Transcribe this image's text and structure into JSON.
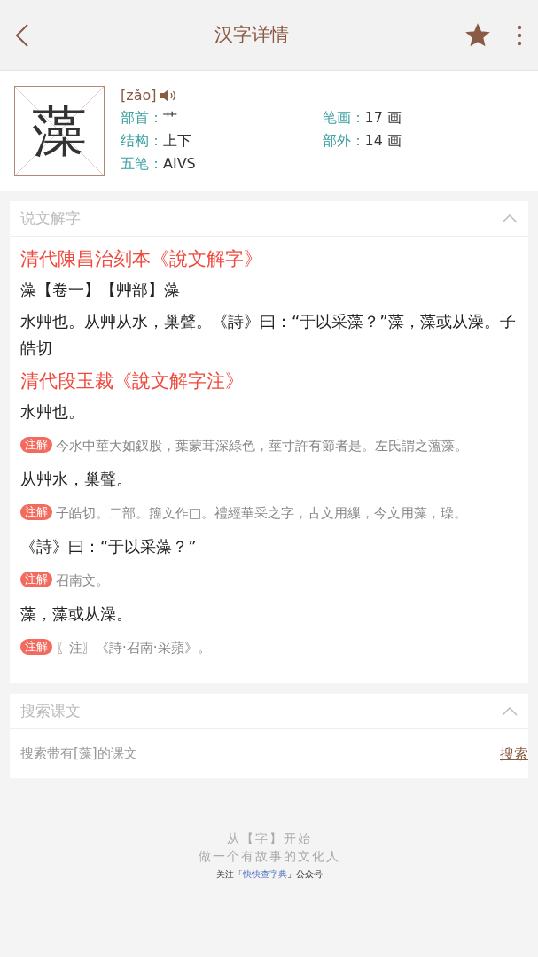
{
  "header": {
    "title": "汉字详情",
    "favorite": true
  },
  "character": {
    "glyph": "藻",
    "pinyin": "[zǎo]",
    "fields": [
      {
        "label": "部首：",
        "value": "艹"
      },
      {
        "label": "笔画：",
        "value": "17 画"
      },
      {
        "label": "结构：",
        "value": "上下"
      },
      {
        "label": "部外：",
        "value": "14 画"
      },
      {
        "label": "五笔：",
        "value": "AIVS"
      }
    ]
  },
  "shuowen": {
    "title": "说文解字",
    "expanded": true,
    "blocks": [
      {
        "kind": "heading",
        "text": "清代陳昌治刻本《說文解字》"
      },
      {
        "kind": "text",
        "text": "藻【卷一】【艸部】藻"
      },
      {
        "kind": "text",
        "text": "水艸也。从艸从水，巢聲。《詩》曰：“于以采藻？”藻，藻或从澡。子皓切"
      },
      {
        "kind": "heading",
        "text": "清代段玉裁《說文解字注》"
      },
      {
        "kind": "text",
        "text": "水艸也。"
      },
      {
        "kind": "note",
        "tag": "注解",
        "text": "今水中莖大如釵股，葉蒙茸深綠色，莖寸許有節者是。左氏謂之薀藻。"
      },
      {
        "kind": "text",
        "text": "从艸水，巢聲。"
      },
      {
        "kind": "note",
        "tag": "注解",
        "text": "子皓切。二部。籒文作□。禮經華采之字，古文用繅，今文用藻，璪。"
      },
      {
        "kind": "text",
        "text": "《詩》曰：“于以采藻？”"
      },
      {
        "kind": "note",
        "tag": "注解",
        "text": "召南文。"
      },
      {
        "kind": "text",
        "text": "藻，藻或从澡。"
      },
      {
        "kind": "note",
        "tag": "注解",
        "text": "〖注〗《詩·召南·采蘋》。"
      }
    ]
  },
  "search_texts": {
    "title": "搜索课文",
    "expanded": true,
    "hint": "搜索带有[藻]的课文",
    "action": "搜索"
  },
  "footer": {
    "lines": [
      "从【字】开始",
      "做一个有故事的文化人"
    ],
    "follow_prefix": "关注「",
    "follow_link": "快快查字典",
    "follow_suffix": "」公众号"
  }
}
